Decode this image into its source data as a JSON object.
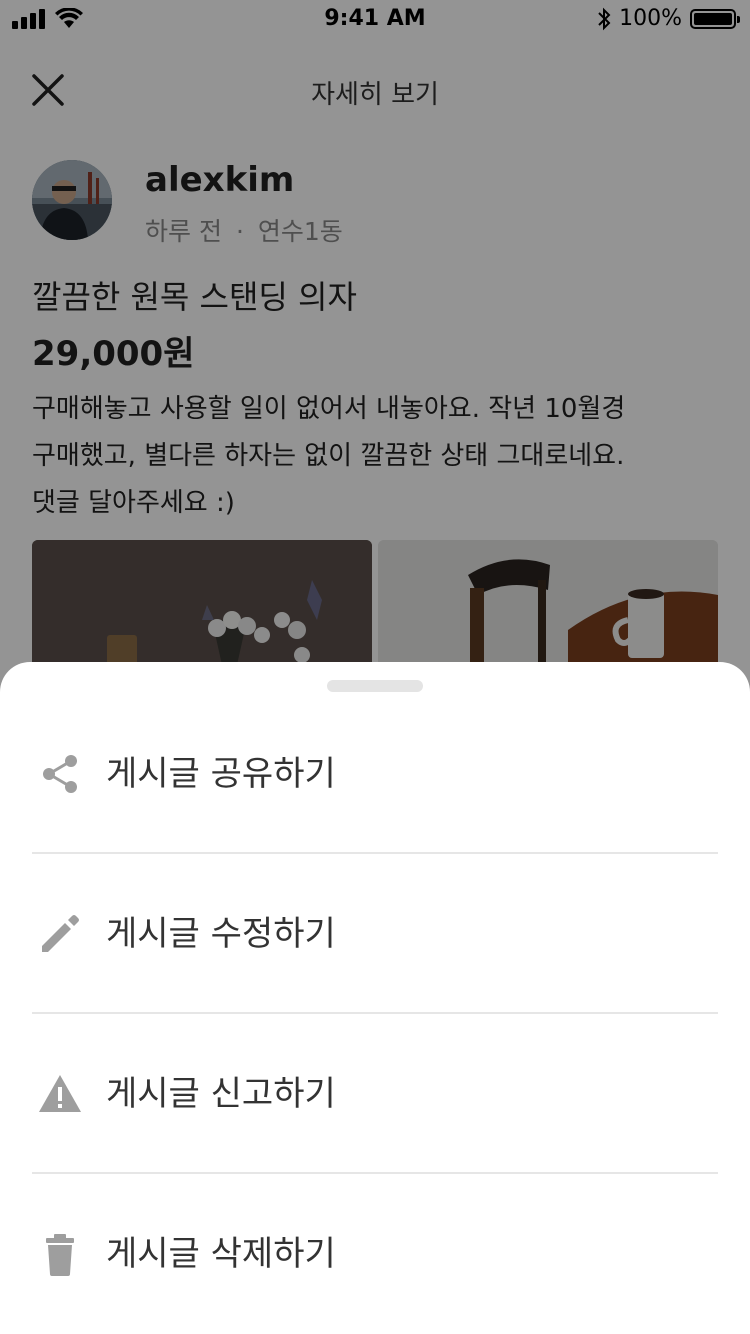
{
  "status_bar": {
    "time": "9:41 AM",
    "battery": "100%"
  },
  "header": {
    "title": "자세히 보기"
  },
  "author": {
    "name": "alexkim",
    "time_ago": "하루 전",
    "separator": "·",
    "location": "연수1동"
  },
  "post": {
    "title": "깔끔한 원목 스탠딩 의자",
    "price": "29,000원",
    "body_lines": [
      "구매해놓고 사용할 일이 없어서 내놓아요. 작년 10월경",
      "구매했고, 별다른 하자는 없이 깔끔한 상태 그대로네요.",
      "댓글 달아주세요 :)"
    ]
  },
  "sheet": {
    "items": [
      {
        "label": "게시글 공유하기",
        "icon": "share-icon"
      },
      {
        "label": "게시글 수정하기",
        "icon": "pencil-icon"
      },
      {
        "label": "게시글 신고하기",
        "icon": "warning-icon"
      },
      {
        "label": "게시글 삭제하기",
        "icon": "trash-icon"
      }
    ],
    "icon_color": "#9e9e9e"
  },
  "colors": {
    "overlay": "rgba(0,0,0,0.42)",
    "text": "#222222",
    "muted": "#888888"
  }
}
